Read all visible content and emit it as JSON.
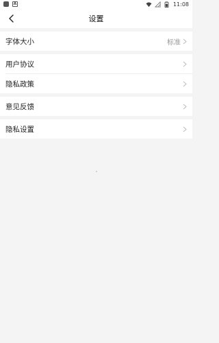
{
  "status_bar": {
    "time": "11:08",
    "left_icons": [
      "app-square-icon",
      "accessibility-a-icon"
    ],
    "right_icons": [
      "wifi-icon",
      "no-signal-icon",
      "battery-icon"
    ]
  },
  "nav": {
    "title": "设置",
    "back_icon": "chevron-left-icon"
  },
  "groups": [
    {
      "items": [
        {
          "label": "字体大小",
          "value": "标准"
        }
      ]
    },
    {
      "items": [
        {
          "label": "用户协议"
        },
        {
          "label": "隐私政策"
        }
      ]
    },
    {
      "items": [
        {
          "label": "意见反馈"
        }
      ]
    },
    {
      "items": [
        {
          "label": "隐私设置"
        }
      ]
    }
  ],
  "colors": {
    "background": "#f4f4f4",
    "surface": "#ffffff",
    "text_primary": "#222222",
    "text_secondary": "#999999",
    "chevron": "#bbbbbb"
  }
}
